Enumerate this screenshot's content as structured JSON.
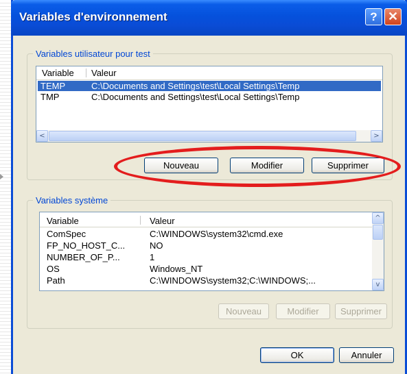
{
  "window": {
    "title": "Variables d'environnement",
    "help_button": "?",
    "close_button": "✕"
  },
  "user_vars": {
    "group_label": "Variables utilisateur pour test",
    "columns": [
      "Variable",
      "Valeur"
    ],
    "rows": [
      {
        "name": "TEMP",
        "value": "C:\\Documents and Settings\\test\\Local Settings\\Temp",
        "selected": true
      },
      {
        "name": "TMP",
        "value": "C:\\Documents and Settings\\test\\Local Settings\\Temp",
        "selected": false
      }
    ],
    "scroll_left": "<",
    "scroll_right": ">",
    "buttons": {
      "new": "Nouveau",
      "edit": "Modifier",
      "delete": "Supprimer"
    }
  },
  "system_vars": {
    "group_label": "Variables système",
    "columns": [
      "Variable",
      "Valeur"
    ],
    "rows": [
      {
        "name": "ComSpec",
        "value": "C:\\WINDOWS\\system32\\cmd.exe"
      },
      {
        "name": "FP_NO_HOST_C...",
        "value": "NO"
      },
      {
        "name": "NUMBER_OF_P...",
        "value": "1"
      },
      {
        "name": "OS",
        "value": "Windows_NT"
      },
      {
        "name": "Path",
        "value": "C:\\WINDOWS\\system32;C:\\WINDOWS;..."
      }
    ],
    "scroll_up": "^",
    "scroll_down": "v",
    "buttons": {
      "new": "Nouveau",
      "edit": "Modifier",
      "delete": "Supprimer"
    }
  },
  "footer": {
    "ok": "OK",
    "cancel": "Annuler"
  },
  "colors": {
    "accent": "#0a4cd6",
    "selection": "#316ac5",
    "annotation": "#e31d1d",
    "group_label": "#0046d5"
  }
}
